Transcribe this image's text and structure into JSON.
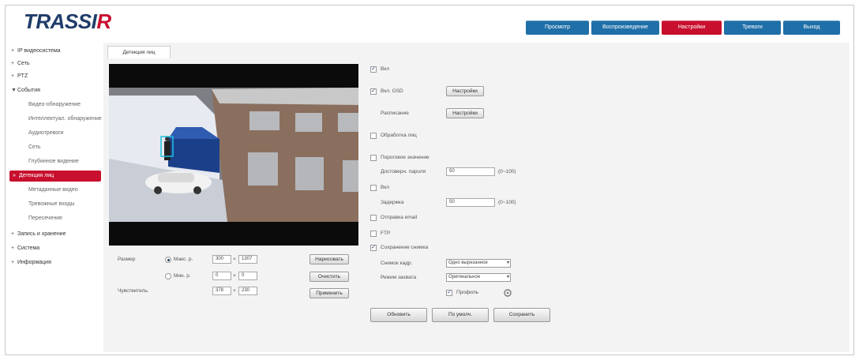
{
  "app": {
    "logo_main": "TRASSI",
    "logo_accent": "R"
  },
  "nav": {
    "items": [
      {
        "label": "Просмотр",
        "color": "#1f6fa8",
        "active": false
      },
      {
        "label": "Воспроизведение",
        "color": "#1f6fa8",
        "active": false
      },
      {
        "label": "Настройки",
        "color": "#c8102e",
        "active": true
      },
      {
        "label": "Тревоги",
        "color": "#1f6fa8",
        "active": false
      },
      {
        "label": "Выход",
        "color": "#1f6fa8",
        "active": false
      }
    ]
  },
  "sidebar": {
    "items": [
      {
        "label": "IP видеосистема",
        "icon": "+",
        "level": 0
      },
      {
        "label": "Сеть",
        "icon": "+",
        "level": 0
      },
      {
        "label": "PTZ",
        "icon": "+",
        "level": 0
      },
      {
        "label": "События",
        "icon": "▼",
        "level": 0
      },
      {
        "label": "Видео-обнаружение",
        "icon": "",
        "level": 1
      },
      {
        "label": "Интеллектуал. обнаружение",
        "icon": "",
        "level": 1
      },
      {
        "label": "Аудиотревоги",
        "icon": "",
        "level": 1
      },
      {
        "label": "Сеть",
        "icon": "",
        "level": 1
      },
      {
        "label": "Глубинное видение",
        "icon": "",
        "level": 1
      },
      {
        "label": "Детекция лиц",
        "icon": "»",
        "level": 1,
        "active": true
      },
      {
        "label": "Метаданные видео",
        "icon": "",
        "level": 1
      },
      {
        "label": "Тревожные входы",
        "icon": "",
        "level": 1
      },
      {
        "label": "Пересечение",
        "icon": "",
        "level": 1
      },
      {
        "label": "Запись и хранение",
        "icon": "+",
        "level": 0
      },
      {
        "label": "Система",
        "icon": "+",
        "level": 0
      },
      {
        "label": "Информация",
        "icon": "+",
        "level": 0
      }
    ]
  },
  "tab": {
    "label": "Детекция лиц"
  },
  "region": {
    "size_label": "Размер",
    "max_label": "Макс. р.",
    "min_label": "Мин. р.",
    "max_w": "300",
    "max_h": "1307",
    "min_w": "0",
    "min_h": "0",
    "sensitivity_label": "Чувствитель.",
    "sens_w": "378",
    "sens_h": "230",
    "draw_btn": "Нарисовать",
    "clear_btn": "Очистить",
    "apply_btn": "Применить"
  },
  "settings": {
    "enable_label": "Вкл",
    "enable_osd_label": "Вкл. OSD",
    "osd_btn": "Настройки",
    "schedule_label": "Расписание",
    "schedule_btn": "Настройки",
    "handle_face_label": "Обработка лиц",
    "thresh_label": "Пороговое значение",
    "thresh_field_label": "Достоверн. пароля",
    "thresh_value": "50",
    "thresh_range": "(0~100)",
    "link_label": "Вкл",
    "delay_label": "Задержка",
    "delay_value": "50",
    "delay_range": "(0~100)",
    "send_email_label": "Отправка email",
    "ftp_label": "FTP",
    "capture_label": "Сохранение снимка",
    "capture_mode_label": "Снимок кадр.",
    "capture_mode_value": "Одно вырезанное",
    "capture_type_label": "Режим захвата",
    "capture_type_value": "Оригинальное",
    "include_label": "Профиль",
    "btn_refresh": "Обновить",
    "btn_default": "По умолч.",
    "btn_save": "Сохранить"
  }
}
